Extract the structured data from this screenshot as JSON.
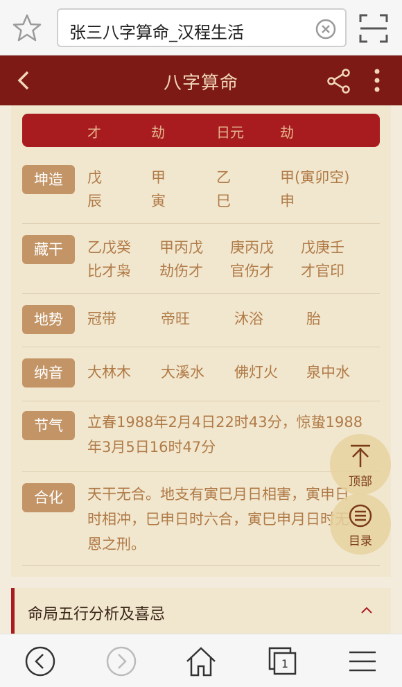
{
  "browser": {
    "url_title": "张三八字算命_汉程生活"
  },
  "header": {
    "title": "八字算命"
  },
  "columns": [
    "才",
    "劫",
    "日元",
    "劫"
  ],
  "rows": {
    "kunzao": {
      "label": "坤造",
      "cells": [
        [
          "戊",
          "辰"
        ],
        [
          "甲",
          "寅"
        ],
        [
          "乙",
          "巳"
        ],
        [
          "甲(寅卯空)",
          "申"
        ]
      ]
    },
    "canggan": {
      "label": "藏干",
      "cells": [
        [
          "乙戊癸",
          "比才枭"
        ],
        [
          "甲丙戊",
          "劫伤才"
        ],
        [
          "庚丙戊",
          "官伤才"
        ],
        [
          "戊庚壬",
          "才官印"
        ]
      ]
    },
    "dishi": {
      "label": "地势",
      "cells": [
        "冠带",
        "帝旺",
        "沐浴",
        "胎"
      ]
    },
    "nayin": {
      "label": "纳音",
      "cells": [
        "大林木",
        "大溪水",
        "佛灯火",
        "泉中水"
      ]
    },
    "jieqi": {
      "label": "节气",
      "lines": [
        "立春1988年2月4日22时43分，惊蛰1988",
        "年3月5日16时47分"
      ]
    },
    "hehua": {
      "label": "合化",
      "lines": [
        "天干无合。地支有寅巳月日相害，寅申日",
        "时相冲，巳申日时六合，寅巳申月日时无",
        "恩之刑。"
      ]
    }
  },
  "floating": {
    "top_label": "顶部",
    "toc_label": "目录"
  },
  "section": {
    "title": "命局五行分析及喜忌"
  },
  "nav": {
    "tab_count": "1"
  },
  "colors": {
    "header_bg": "#7d1a15",
    "column_header_bg": "#a81c20",
    "tag_bg": "#c39466",
    "text_brown": "#b07a47"
  }
}
